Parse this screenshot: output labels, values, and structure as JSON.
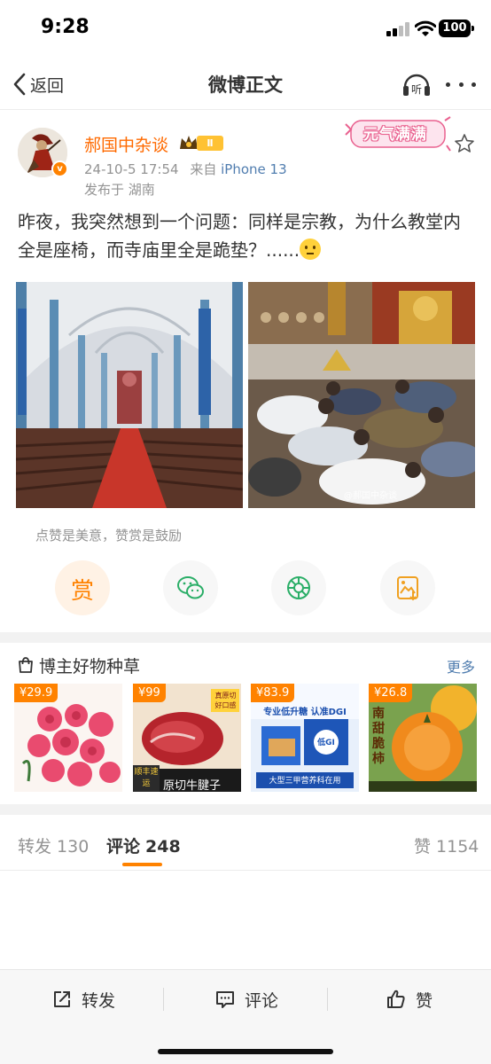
{
  "status_bar": {
    "time": "9:28",
    "battery": "100"
  },
  "nav": {
    "back_label": "返回",
    "title": "微博正文",
    "listen_icon": "listen-icon",
    "more_icon": "more-icon"
  },
  "post": {
    "author": "郝国中杂谈",
    "level": "Ⅱ",
    "date": "24-10-5 17:54",
    "source_prefix": "来自",
    "device": "iPhone 13",
    "location": "发布于 湖南",
    "sticker_text": "元气满满",
    "text": "昨夜，我突然想到一个问题：同样是宗教，为什么教堂内全是座椅，而寺庙里全是跪垫？......",
    "image_watermark": "@郝国中杂谈"
  },
  "reward": {
    "tip": "点赞是美意，赞赏是鼓励",
    "reward_glyph": "赏",
    "icons": [
      "reward-icon",
      "wechat-icon",
      "moments-icon",
      "save-image-icon"
    ]
  },
  "shop": {
    "title": "博主好物种草",
    "more": "更多",
    "products": [
      {
        "price": "¥29.9",
        "caption": ""
      },
      {
        "price": "¥99",
        "caption": "原切牛腱子",
        "tag": "顺丰速运",
        "badge": "真原切 好口感"
      },
      {
        "price": "¥83.9",
        "caption": "大型三甲营养科在用",
        "headline": "专业低升糖 认准DGI",
        "badge": "低GI"
      },
      {
        "price": "¥26.8",
        "caption": "南甜脆柿"
      }
    ]
  },
  "tabs": {
    "repost_label": "转发",
    "repost_count": "130",
    "comment_label": "评论",
    "comment_count": "248",
    "like_label": "赞",
    "like_count": "1154"
  },
  "toolbar": {
    "repost": "转发",
    "comment": "评论",
    "like": "赞"
  },
  "colors": {
    "accent": "#ff8200",
    "link": "#507daf",
    "author": "#ff6a00",
    "muted": "#939393"
  }
}
